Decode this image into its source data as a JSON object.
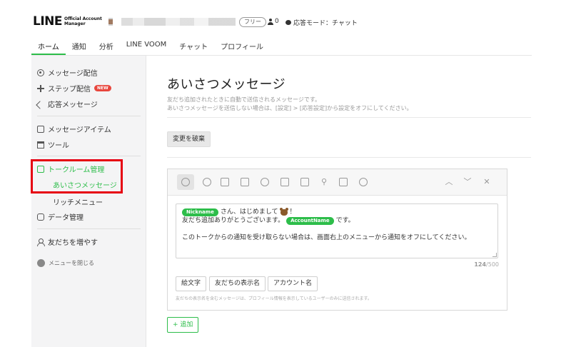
{
  "header": {
    "logo_main": "LINE",
    "logo_sub_1": "Official Account",
    "logo_sub_2": "Manager",
    "plan_badge": "フリー",
    "follower_count": "0",
    "response_mode": "応答モード：チャット"
  },
  "tabs": [
    {
      "label": "ホーム",
      "active": true
    },
    {
      "label": "通知"
    },
    {
      "label": "分析"
    },
    {
      "label": "LINE VOOM"
    },
    {
      "label": "チャット"
    },
    {
      "label": "プロフィール"
    }
  ],
  "sidebar": {
    "items": [
      {
        "label": "メッセージ配信",
        "icon": "broadcast-icon"
      },
      {
        "label": "ステップ配信",
        "icon": "step-icon",
        "badge": "NEW"
      },
      {
        "label": "応答メッセージ",
        "icon": "reply-icon"
      },
      {
        "label": "メッセージアイテム",
        "icon": "message-item-icon"
      },
      {
        "label": "ツール",
        "icon": "gift-icon"
      },
      {
        "label": "トークルーム管理",
        "icon": "talkroom-icon"
      },
      {
        "label": "あいさつメッセージ"
      },
      {
        "label": "リッチメニュー"
      },
      {
        "label": "データ管理",
        "icon": "data-icon"
      },
      {
        "label": "友だちを増やす",
        "icon": "add-friend-icon"
      },
      {
        "label": "メニューを閉じる",
        "icon": "close-menu-icon"
      }
    ]
  },
  "main": {
    "title": "あいさつメッセージ",
    "desc_1": "友だち追加されたときに自動で送信されるメッセージです。",
    "desc_2": "あいさつメッセージを送信しない場合は、[設定] > [応答設定]から設定をオフにしてください。",
    "discard_label": "変更を破棄",
    "message": {
      "tag_nickname": "Nickname",
      "line1_text": "さん、はじめまして",
      "line1_end": "！",
      "line2_text": "友だち追加ありがとうございます。",
      "tag_account": "AccountName",
      "line2_end": "です。",
      "line3_text": "このトークからの通知を受け取らない場合は、画面右上のメニューから通知をオフにしてください。"
    },
    "counter_current": "124",
    "counter_max": "/500",
    "insert_buttons": [
      "絵文字",
      "友だちの表示名",
      "アカウント名"
    ],
    "note": "友だちの表示名を含むメッセージは、プロフィール情報を表示しているユーザーのみに送信されます。",
    "add_label": "+ 追加"
  },
  "colors": {
    "brand_green": "#2dbd4a",
    "highlight_red": "#e60012"
  }
}
